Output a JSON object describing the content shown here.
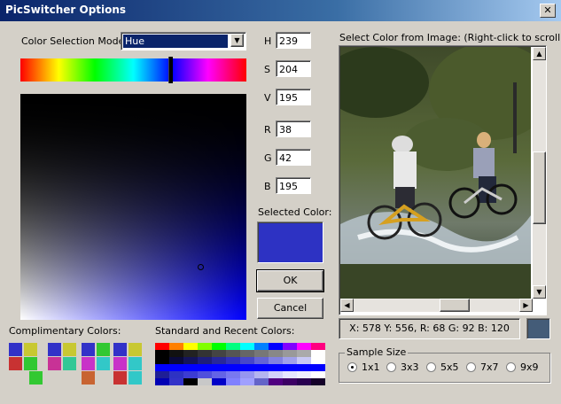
{
  "window": {
    "title": "PicSwitcher Options",
    "close_symbol": "✕"
  },
  "mode": {
    "label": "Color Selection Mode:",
    "value": "Hue"
  },
  "hsv": {
    "h_label": "H",
    "h": "239",
    "s_label": "S",
    "s": "204",
    "v_label": "V",
    "v": "195"
  },
  "rgb": {
    "r_label": "R",
    "r": "38",
    "g_label": "G",
    "g": "42",
    "b_label": "B",
    "b": "195"
  },
  "selected": {
    "label": "Selected Color:",
    "color": "#2d32c3"
  },
  "buttons": {
    "ok": "OK",
    "cancel": "Cancel"
  },
  "image": {
    "label": "Select Color from Image: (Right-click to scroll)",
    "status": "X: 578 Y: 556, R: 68 G: 92 B: 120",
    "status_color": "#445c78"
  },
  "complementary": {
    "label": "Complimentary Colors:",
    "colors": [
      [
        "#3232c8",
        "#c8c832",
        "#c83232",
        "#32c832"
      ],
      [
        "#3232c8",
        "#c8c832",
        "#c83296",
        "#32c896"
      ],
      [
        "#3232c8",
        "#32c832",
        "#c832c8",
        "#32c8c8"
      ],
      [
        "#3232c8",
        "#c8c832",
        "#c832c8",
        "#32c8c8"
      ]
    ]
  },
  "standard": {
    "label": "Standard and Recent Colors:"
  },
  "sample": {
    "label": "Sample Size",
    "options": [
      "1x1",
      "3x3",
      "5x5",
      "7x7",
      "9x9"
    ],
    "selected": "1x1"
  }
}
